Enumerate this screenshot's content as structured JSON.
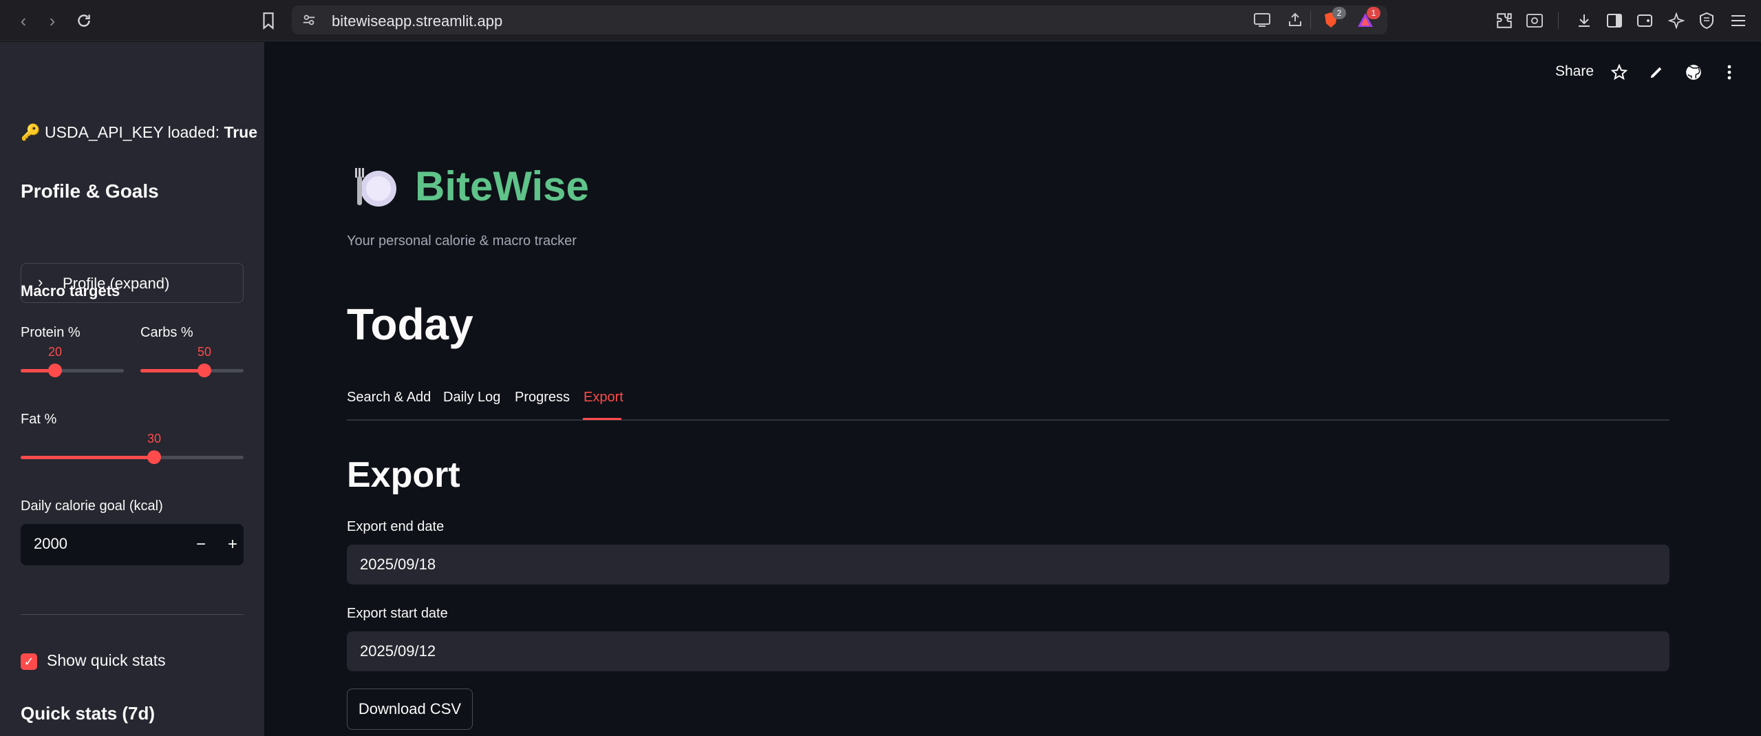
{
  "browser": {
    "url": "bitewiseapp.streamlit.app",
    "badges": {
      "brave": "2",
      "rewards": "1"
    }
  },
  "toolbar": {
    "share_label": "Share"
  },
  "sidebar": {
    "api_status_prefix": "USDA_API_KEY loaded:",
    "api_status_value": "True",
    "profile_heading": "Profile & Goals",
    "profile_expander": "Profile (expand)",
    "macro_heading": "Macro targets",
    "sliders": [
      {
        "label": "Protein %",
        "value": "20",
        "fraction": 0.2
      },
      {
        "label": "Carbs %",
        "value": "50",
        "fraction": 0.5
      },
      {
        "label": "Fat %",
        "value": "30",
        "fraction": 0.3
      }
    ],
    "calorie_label": "Daily calorie goal (kcal)",
    "calorie_value": "2000",
    "quick_stats_checkbox": "Show quick stats",
    "quick_stats_checked": true,
    "quick_stats_heading": "Quick stats (7d)"
  },
  "main": {
    "app_title": "BiteWise",
    "app_subtitle": "Your personal calorie & macro tracker",
    "section_title": "Today",
    "tabs": [
      {
        "label": "Search & Add",
        "active": false
      },
      {
        "label": "Daily Log",
        "active": false
      },
      {
        "label": "Progress",
        "active": false
      },
      {
        "label": "Export",
        "active": true
      }
    ],
    "export_heading": "Export",
    "end_date_label": "Export end date",
    "end_date_value": "2025/09/18",
    "start_date_label": "Export start date",
    "start_date_value": "2025/09/12",
    "download_button": "Download CSV"
  },
  "colors": {
    "accent": "#ff4b4b",
    "brand_green": "#5fc38a",
    "background": "#0e1117",
    "sidebar": "#262730"
  }
}
